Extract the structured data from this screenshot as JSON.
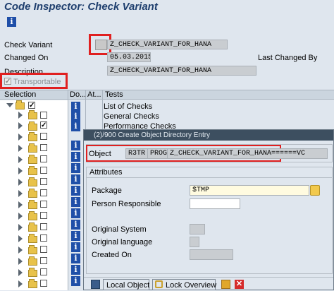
{
  "window": {
    "title": "Code Inspector: Check Variant"
  },
  "header": {
    "check_variant_label": "Check Variant",
    "check_variant_value": "Z_CHECK_VARIANT_FOR_HANA",
    "changed_on_label": "Changed On",
    "changed_on_value": "05.03.2015",
    "last_changed_by_label": "Last Changed By",
    "description_label": "Description",
    "description_value": "Z_CHECK_VARIANT_FOR_HANA",
    "transportable_label": "Transportable"
  },
  "table": {
    "columns": [
      "Selection",
      "Do...",
      "At...",
      "Tests"
    ],
    "rows": [
      {
        "test": "List of Checks"
      },
      {
        "test": "General Checks"
      },
      {
        "test": "Performance Checks"
      }
    ]
  },
  "dialog": {
    "title": "(2)/900 Create Object Directory Entry",
    "object_label": "Object",
    "object_pgmid": "R3TR",
    "object_type": "PROG",
    "object_name": "Z_CHECK_VARIANT_FOR_HANA======VC",
    "attributes_label": "Attributes",
    "package_label": "Package",
    "package_value": "$TMP",
    "person_label": "Person Responsible",
    "original_system_label": "Original System",
    "original_language_label": "Original language",
    "created_on_label": "Created On",
    "local_object_button": "Local Object",
    "lock_overview_button": "Lock Overview"
  }
}
